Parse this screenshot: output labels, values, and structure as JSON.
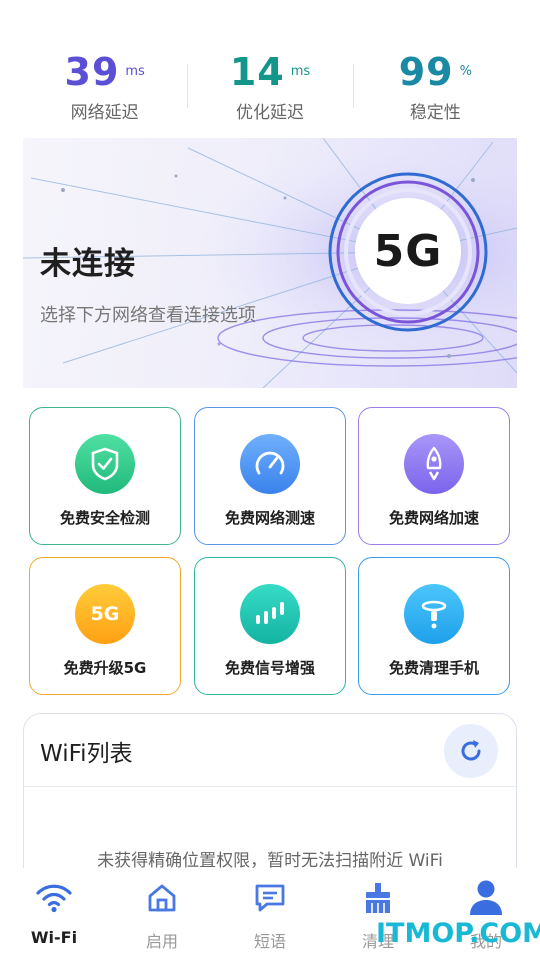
{
  "stats": [
    {
      "value": "39",
      "unit": "ms",
      "label": "网络延迟",
      "color": "#5b4fd6"
    },
    {
      "value": "14",
      "unit": "ms",
      "label": "优化延迟",
      "color": "#13968a"
    },
    {
      "value": "99",
      "unit": "%",
      "label": "稳定性",
      "color": "#1a8aa4"
    }
  ],
  "banner": {
    "title": "未连接",
    "subtitle": "选择下方网络查看连接选项",
    "badge": "5G"
  },
  "features": [
    {
      "label": "免费安全检测",
      "icon": "shield-check-icon",
      "border": "#3fb58f",
      "icon_color": "#2fcf8e"
    },
    {
      "label": "免费网络测速",
      "icon": "speedometer-icon",
      "border": "#5a95e8",
      "icon_color": "#4f8ef0"
    },
    {
      "label": "免费网络加速",
      "icon": "rocket-icon",
      "border": "#9a7ee6",
      "icon_color": "#8b73ee"
    },
    {
      "label": "免费升级5G",
      "icon": "5g-icon",
      "icon_text": "5G",
      "border": "#f0a832",
      "icon_color": "#ffb21e"
    },
    {
      "label": "免费信号增强",
      "icon": "signal-bars-icon",
      "border": "#2fb5a5",
      "icon_color": "#1ec8b4"
    },
    {
      "label": "免费清理手机",
      "icon": "broom-icon",
      "border": "#3a9be6",
      "icon_color": "#2aa9ee"
    }
  ],
  "wifi": {
    "title": "WiFi列表",
    "empty_message": "未获得精确位置权限，暂时无法扫描附近 WiFi"
  },
  "nav": [
    {
      "label": "Wi-Fi",
      "icon": "wifi-icon",
      "active": true
    },
    {
      "label": "启用",
      "icon": "home-icon",
      "active": false
    },
    {
      "label": "短语",
      "icon": "message-icon",
      "active": false
    },
    {
      "label": "清理",
      "icon": "broom-icon",
      "active": false
    },
    {
      "label": "我的",
      "icon": "user-icon",
      "active": false
    }
  ],
  "watermark": "ITMOP.COM",
  "colors": {
    "accent": "#3a6ee0",
    "nav_active": "#3a6ee0",
    "nav_inactive": "#4a78e2"
  }
}
